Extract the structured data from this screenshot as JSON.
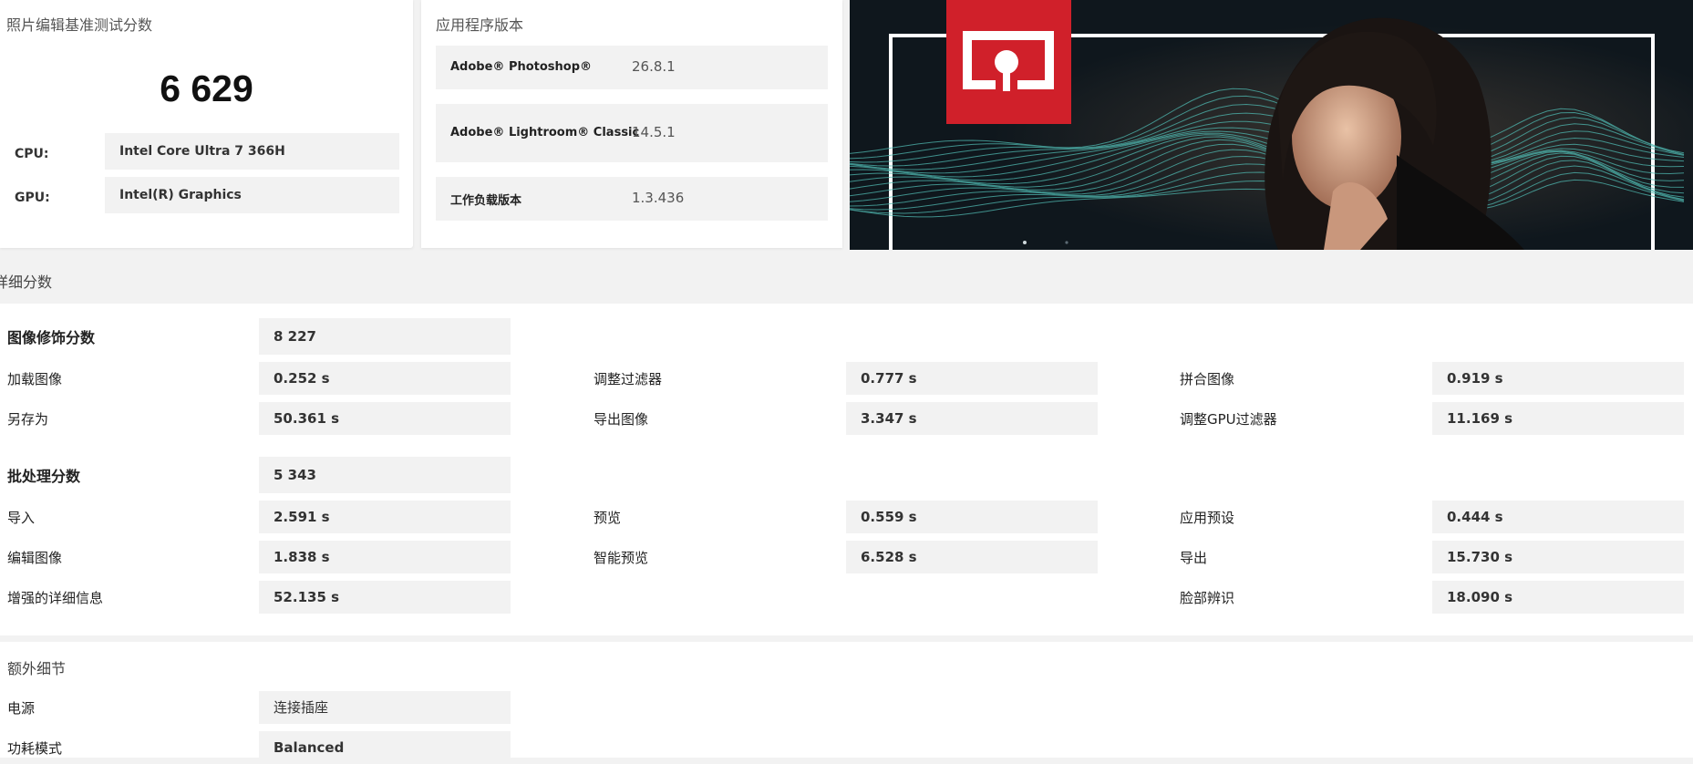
{
  "score_card": {
    "title": "照片编辑基准测试分数",
    "score": "6 629",
    "cpu_label": "CPU:",
    "cpu_value": "Intel Core Ultra 7 366H",
    "gpu_label": "GPU:",
    "gpu_value": "Intel(R) Graphics"
  },
  "apps_card": {
    "title": "应用程序版本",
    "rows": [
      {
        "name": "Adobe® Photoshop®",
        "version": "26.8.1"
      },
      {
        "name": "Adobe® Lightroom® Classic",
        "version": "14.5.1"
      },
      {
        "name": "工作负载版本",
        "version": "1.3.436"
      }
    ]
  },
  "banner": {
    "brand_color": "#d0202a",
    "line_color": "#4fb8b0"
  },
  "details": {
    "title": "详细分数",
    "retouch": {
      "label": "图像修饰分数",
      "score": "8 227",
      "items": [
        {
          "label": "加载图像",
          "value": "0.252 s"
        },
        {
          "label": "调整过滤器",
          "value": "0.777 s"
        },
        {
          "label": "拼合图像",
          "value": "0.919 s"
        },
        {
          "label": "另存为",
          "value": "50.361 s"
        },
        {
          "label": "导出图像",
          "value": "3.347 s"
        },
        {
          "label": "调整GPU过滤器",
          "value": "11.169 s"
        }
      ]
    },
    "batch": {
      "label": "批处理分数",
      "score": "5 343",
      "items": [
        {
          "label": "导入",
          "value": "2.591 s"
        },
        {
          "label": "预览",
          "value": "0.559 s"
        },
        {
          "label": "应用预设",
          "value": "0.444 s"
        },
        {
          "label": "编辑图像",
          "value": "1.838 s"
        },
        {
          "label": "智能预览",
          "value": "6.528 s"
        },
        {
          "label": "导出",
          "value": "15.730 s"
        },
        {
          "label": "增强的详细信息",
          "value": "52.135 s"
        },
        {
          "label": "脸部辨识",
          "value": "18.090 s"
        }
      ]
    }
  },
  "extra": {
    "title": "额外细节",
    "items": [
      {
        "label": "电源",
        "value": "连接插座"
      },
      {
        "label": "功耗模式",
        "value": "Balanced"
      }
    ]
  }
}
